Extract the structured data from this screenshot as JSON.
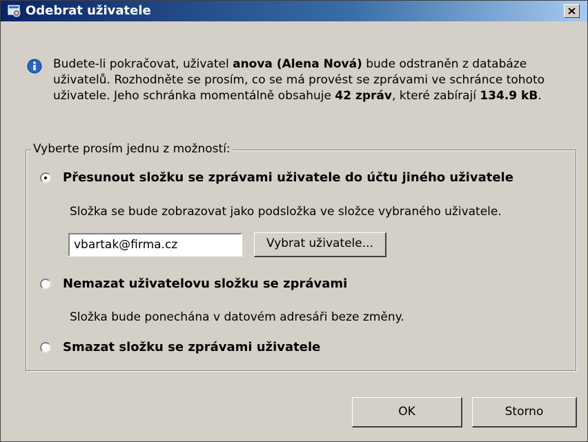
{
  "window": {
    "title": "Odebrat uživatele",
    "app_icon": "settings-window-icon",
    "close_icon": "close-icon"
  },
  "info": {
    "icon": "info-icon",
    "text_before_user": "Budete-li pokračovat, uživatel ",
    "user": "anova (Alena Nová)",
    "text_after_user": " bude odstraněn z databáze uživatelů. Rozhodněte se prosím, co se má provést se zprávami ve schránce tohoto uživatele. Jeho schránka momentálně obsahuje ",
    "message_count": "42 zpráv",
    "text_after_count": ", které zabírají ",
    "size": "134.9 kB",
    "text_end": "."
  },
  "group": {
    "legend": "Vyberte prosím jednu z možností:",
    "options": [
      {
        "label": "Přesunout složku se zprávami uživatele do účtu jiného uživatele",
        "description": "Složka se bude zobrazovat jako podsložka ve složce vybraného uživatele.",
        "checked": true
      },
      {
        "label": "Nemazat uživatelovu složku se zprávami",
        "description": "Složka bude ponechána v datovém adresáři beze změny.",
        "checked": false
      },
      {
        "label": "Smazat složku se zprávami uživatele",
        "checked": false
      }
    ],
    "target_user_value": "vbartak@firma.cz",
    "select_user_label": "Vybrat uživatele..."
  },
  "buttons": {
    "ok": "OK",
    "cancel": "Storno"
  }
}
